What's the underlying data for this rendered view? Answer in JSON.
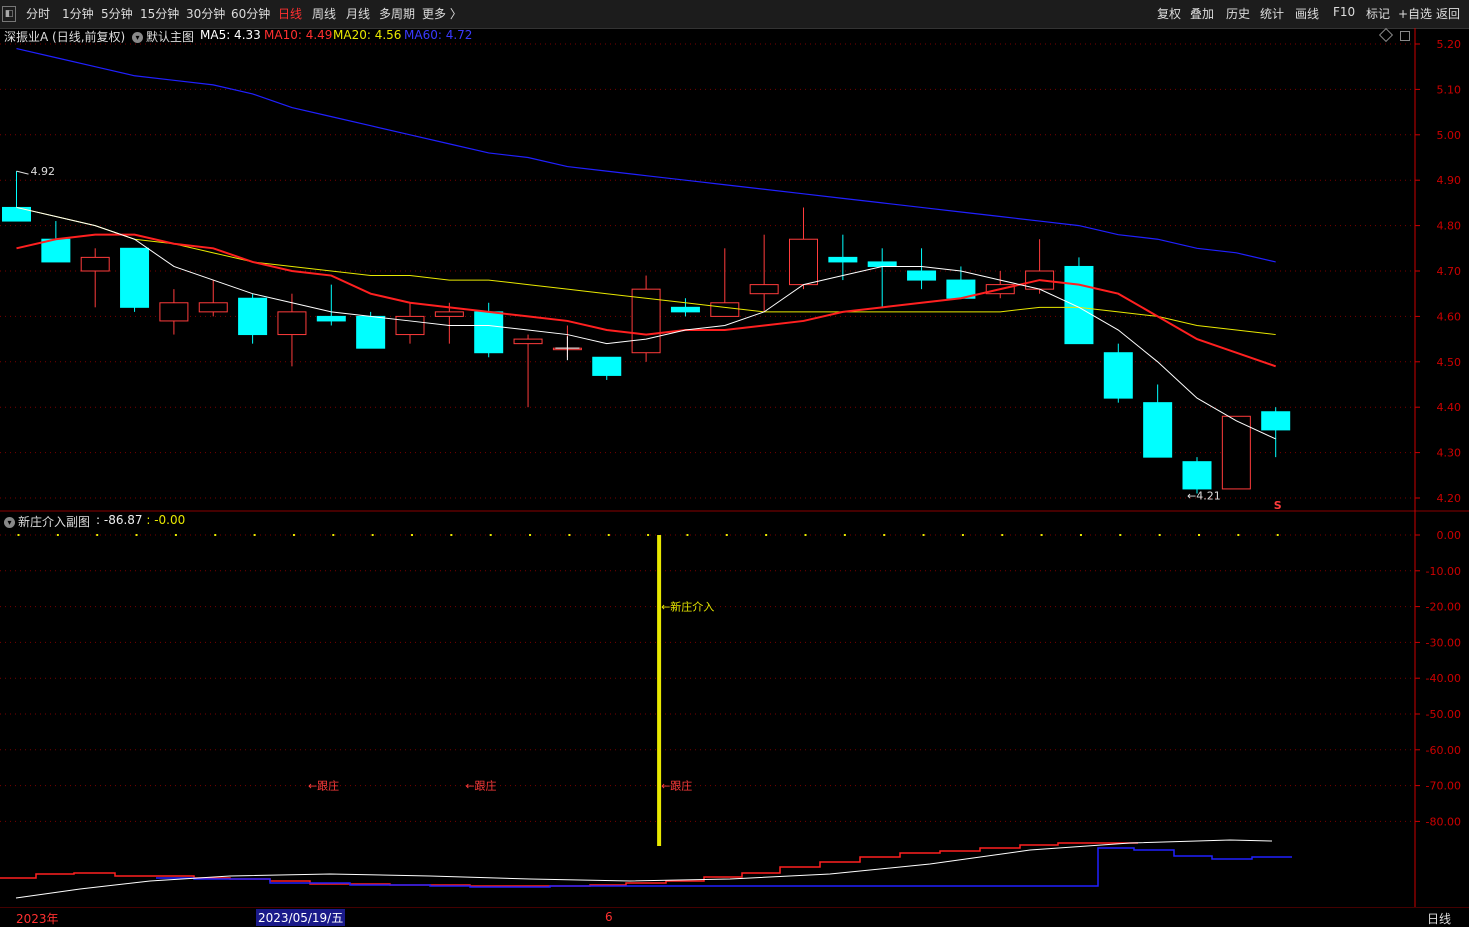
{
  "period_tabs": [
    {
      "label": "分时",
      "active": false
    },
    {
      "label": "1分钟",
      "active": false
    },
    {
      "label": "5分钟",
      "active": false
    },
    {
      "label": "15分钟",
      "active": false
    },
    {
      "label": "30分钟",
      "active": false
    },
    {
      "label": "60分钟",
      "active": false
    },
    {
      "label": "日线",
      "active": true
    },
    {
      "label": "周线",
      "active": false
    },
    {
      "label": "月线",
      "active": false
    },
    {
      "label": "多周期",
      "active": false
    },
    {
      "label": "更多 〉",
      "active": false
    }
  ],
  "right_tools": [
    "复权",
    "叠加",
    "历史",
    "统计",
    "画线",
    "F10",
    "标记",
    "+自选",
    "返回"
  ],
  "main_header": {
    "stock": "深振业A (日线,前复权)",
    "template": "默认主图",
    "ma5": "MA5: 4.33",
    "ma10": "MA10: 4.49",
    "ma20": "MA20: 4.56",
    "ma60": "MA60: 4.72"
  },
  "sub_header": {
    "name": "新庄介入副图",
    "values": "  : -86.87  : -0.00"
  },
  "annotations": {
    "high": "4.92",
    "low": "←4.21",
    "new_dealer": "新庄介入",
    "follow": "←跟庄",
    "s_mark": "S"
  },
  "bottom": {
    "year": "2023年",
    "date": "2023/05/19/五",
    "month": "6",
    "period": "日线"
  },
  "colors": {
    "up": "#ff3c3c",
    "down": "#00ffff",
    "ma5": "#ffffff",
    "ma10": "#ff2020",
    "ma20": "#e8e800",
    "ma60": "#2020ff",
    "axis": "#cc0000",
    "grid": "#7a0000"
  },
  "chart_data": [
    {
      "type": "candlestick",
      "title": "深振业A (日线,前复权)",
      "y_ticks": [
        5.2,
        5.1,
        5.0,
        4.9,
        4.8,
        4.7,
        4.6,
        4.5,
        4.4,
        4.3,
        4.2
      ],
      "ylim": [
        4.17,
        5.22
      ],
      "candles": [
        {
          "o": 4.84,
          "h": 4.92,
          "l": 4.81,
          "c": 4.81
        },
        {
          "o": 4.77,
          "h": 4.81,
          "l": 4.72,
          "c": 4.72
        },
        {
          "o": 4.7,
          "h": 4.75,
          "l": 4.62,
          "c": 4.73
        },
        {
          "o": 4.75,
          "h": 4.75,
          "l": 4.61,
          "c": 4.62
        },
        {
          "o": 4.59,
          "h": 4.66,
          "l": 4.56,
          "c": 4.63
        },
        {
          "o": 4.61,
          "h": 4.68,
          "l": 4.6,
          "c": 4.63
        },
        {
          "o": 4.64,
          "h": 4.65,
          "l": 4.54,
          "c": 4.56
        },
        {
          "o": 4.56,
          "h": 4.65,
          "l": 4.49,
          "c": 4.61
        },
        {
          "o": 4.6,
          "h": 4.67,
          "l": 4.58,
          "c": 4.59
        },
        {
          "o": 4.6,
          "h": 4.61,
          "l": 4.53,
          "c": 4.53
        },
        {
          "o": 4.56,
          "h": 4.63,
          "l": 4.54,
          "c": 4.6
        },
        {
          "o": 4.6,
          "h": 4.63,
          "l": 4.54,
          "c": 4.61
        },
        {
          "o": 4.61,
          "h": 4.63,
          "l": 4.51,
          "c": 4.52
        },
        {
          "o": 4.54,
          "h": 4.56,
          "l": 4.4,
          "c": 4.55
        },
        {
          "o": 4.53,
          "h": 4.58,
          "l": 4.51,
          "c": 4.53
        },
        {
          "o": 4.51,
          "h": 4.51,
          "l": 4.46,
          "c": 4.47
        },
        {
          "o": 4.52,
          "h": 4.69,
          "l": 4.5,
          "c": 4.66
        },
        {
          "o": 4.62,
          "h": 4.64,
          "l": 4.6,
          "c": 4.61
        },
        {
          "o": 4.6,
          "h": 4.75,
          "l": 4.6,
          "c": 4.63
        },
        {
          "o": 4.65,
          "h": 4.78,
          "l": 4.61,
          "c": 4.67
        },
        {
          "o": 4.67,
          "h": 4.84,
          "l": 4.66,
          "c": 4.77
        },
        {
          "o": 4.73,
          "h": 4.78,
          "l": 4.68,
          "c": 4.72
        },
        {
          "o": 4.72,
          "h": 4.75,
          "l": 4.62,
          "c": 4.71
        },
        {
          "o": 4.7,
          "h": 4.75,
          "l": 4.66,
          "c": 4.68
        },
        {
          "o": 4.68,
          "h": 4.71,
          "l": 4.64,
          "c": 4.64
        },
        {
          "o": 4.65,
          "h": 4.7,
          "l": 4.64,
          "c": 4.67
        },
        {
          "o": 4.66,
          "h": 4.77,
          "l": 4.65,
          "c": 4.7
        },
        {
          "o": 4.71,
          "h": 4.73,
          "l": 4.54,
          "c": 4.54
        },
        {
          "o": 4.52,
          "h": 4.54,
          "l": 4.41,
          "c": 4.42
        },
        {
          "o": 4.41,
          "h": 4.45,
          "l": 4.29,
          "c": 4.29
        },
        {
          "o": 4.28,
          "h": 4.29,
          "l": 4.21,
          "c": 4.22
        },
        {
          "o": 4.22,
          "h": 4.38,
          "l": 4.22,
          "c": 4.38
        },
        {
          "o": 4.39,
          "h": 4.4,
          "l": 4.29,
          "c": 4.35
        }
      ],
      "ma5": [
        4.84,
        4.82,
        4.8,
        4.77,
        4.71,
        4.68,
        4.65,
        4.63,
        4.61,
        4.6,
        4.59,
        4.58,
        4.58,
        4.57,
        4.56,
        4.54,
        4.55,
        4.57,
        4.58,
        4.61,
        4.67,
        4.69,
        4.71,
        4.71,
        4.7,
        4.68,
        4.66,
        4.62,
        4.57,
        4.5,
        4.42,
        4.37,
        4.33
      ],
      "ma10": [
        4.75,
        4.77,
        4.78,
        4.78,
        4.76,
        4.75,
        4.72,
        4.7,
        4.69,
        4.65,
        4.63,
        4.62,
        4.61,
        4.6,
        4.59,
        4.57,
        4.56,
        4.57,
        4.57,
        4.58,
        4.59,
        4.61,
        4.62,
        4.63,
        4.64,
        4.66,
        4.68,
        4.67,
        4.65,
        4.6,
        4.55,
        4.52,
        4.49
      ],
      "ma20": [
        4.84,
        4.82,
        4.8,
        4.77,
        4.76,
        4.74,
        4.72,
        4.71,
        4.7,
        4.69,
        4.69,
        4.68,
        4.68,
        4.67,
        4.66,
        4.65,
        4.64,
        4.63,
        4.62,
        4.61,
        4.61,
        4.61,
        4.61,
        4.61,
        4.61,
        4.61,
        4.62,
        4.62,
        4.61,
        4.6,
        4.58,
        4.57,
        4.56
      ],
      "ma60": [
        5.19,
        5.17,
        5.15,
        5.13,
        5.12,
        5.11,
        5.09,
        5.06,
        5.04,
        5.02,
        5.0,
        4.98,
        4.96,
        4.95,
        4.93,
        4.92,
        4.91,
        4.9,
        4.89,
        4.88,
        4.87,
        4.86,
        4.85,
        4.84,
        4.83,
        4.82,
        4.81,
        4.8,
        4.78,
        4.77,
        4.75,
        4.74,
        4.72
      ]
    },
    {
      "type": "bar",
      "title": "新庄介入副图",
      "y_ticks": [
        0.0,
        -10.0,
        -20.0,
        -30.0,
        -40.0,
        -50.0,
        -60.0,
        -70.0,
        -80.0
      ],
      "ylim": [
        -100,
        2
      ],
      "signal_index": 16,
      "signal_value": -86.87,
      "follow_indices": [
        7,
        11,
        16
      ],
      "dot_value": 0.0
    }
  ]
}
